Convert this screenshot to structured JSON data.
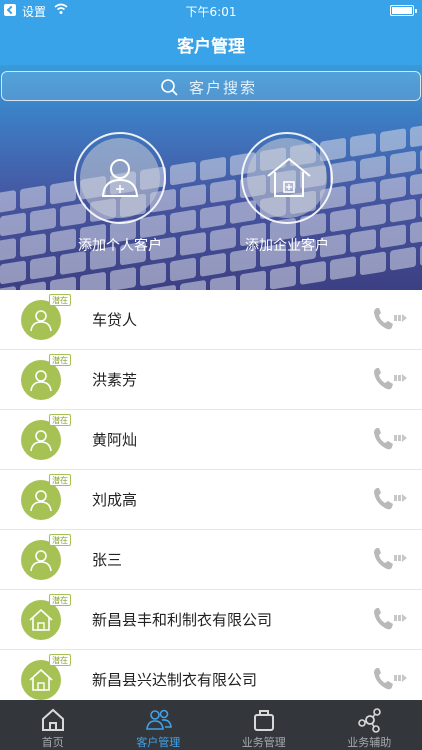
{
  "status_bar": {
    "carrier": "设置",
    "time": "下午6:01"
  },
  "nav": {
    "title": "客户管理"
  },
  "search": {
    "placeholder": "客户搜索"
  },
  "quick_actions": [
    {
      "label": "添加个人客户",
      "icon": "add-person-icon"
    },
    {
      "label": "添加企业客户",
      "icon": "add-company-icon"
    }
  ],
  "customers": [
    {
      "name": "车贷人",
      "type": "person",
      "status": "潜在"
    },
    {
      "name": "洪素芳",
      "type": "person",
      "status": "潜在"
    },
    {
      "name": "黄阿灿",
      "type": "person",
      "status": "潜在"
    },
    {
      "name": "刘成高",
      "type": "person",
      "status": "潜在"
    },
    {
      "name": "张三",
      "type": "person",
      "status": "潜在"
    },
    {
      "name": "新昌县丰和利制衣有限公司",
      "type": "company",
      "status": "潜在"
    },
    {
      "name": "新昌县兴达制衣有限公司",
      "type": "company",
      "status": "潜在"
    }
  ],
  "tabs": [
    {
      "label": "首页",
      "icon": "home-icon",
      "active": false
    },
    {
      "label": "客户管理",
      "icon": "customers-icon",
      "active": true
    },
    {
      "label": "业务管理",
      "icon": "briefcase-icon",
      "active": false
    },
    {
      "label": "业务辅助",
      "icon": "network-icon",
      "active": false
    }
  ],
  "colors": {
    "nav_blue": "#38a3e8",
    "avatar_green": "#a6c255",
    "tabbar_bg": "#33363b",
    "tab_active": "#3fa3ea"
  }
}
